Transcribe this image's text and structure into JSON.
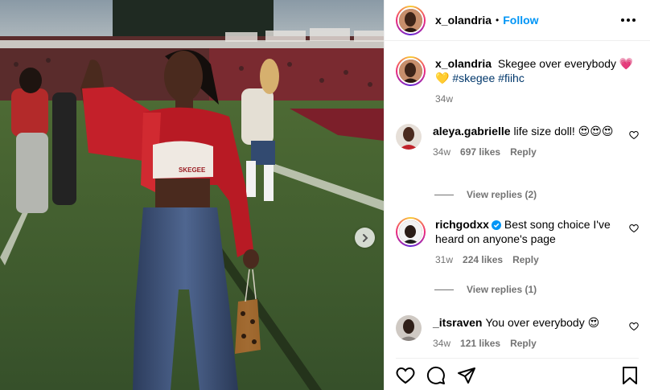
{
  "post": {
    "author": "x_olandria",
    "separator": "•",
    "follow_label": "Follow",
    "caption_text": "Skegee over everybody",
    "caption_emoji": "💗💛",
    "hashtags": [
      "#skegee",
      "#fiihc"
    ],
    "age": "34w",
    "shirt_text": "SKEGEE"
  },
  "comments": [
    {
      "user": "aleya.gabrielle",
      "text": "life size doll! 😍😍😍",
      "age": "34w",
      "likes": "697 likes",
      "reply": "Reply",
      "view_replies": "View replies (2)"
    },
    {
      "user": "richgodxx",
      "text": "Best song choice I've heard on anyone's page",
      "age": "31w",
      "likes": "224 likes",
      "reply": "Reply",
      "view_replies": "View replies (1)"
    },
    {
      "user": "_itsraven",
      "text": "You over everybody 😍",
      "age": "34w",
      "likes": "121 likes",
      "reply": "Reply"
    }
  ],
  "icons": {
    "next": "chevron-right-icon",
    "like": "heart-icon",
    "comment": "comment-bubble-icon",
    "share": "paper-plane-icon",
    "save": "bookmark-icon",
    "verified": "verified-badge-icon",
    "more": "more-dots-icon"
  },
  "colors": {
    "follow": "#0095f6",
    "hashtag": "#00376b",
    "meta": "#737373",
    "verified": "#0095f6"
  }
}
